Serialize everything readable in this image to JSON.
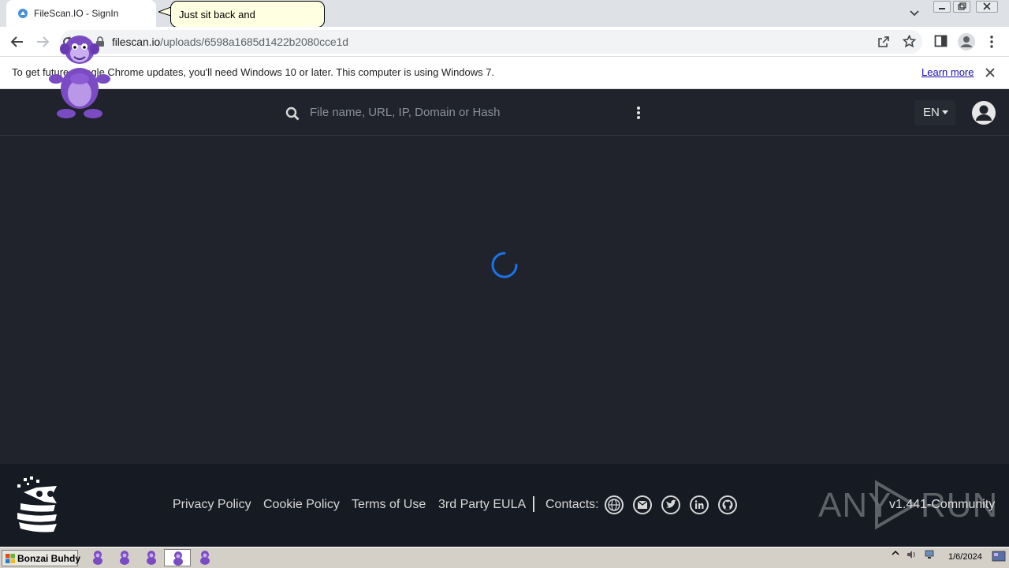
{
  "browser": {
    "tab_title": "FileScan.IO - SignIn",
    "url_host": "filescan.io",
    "url_path": "/uploads/6598a1685d1422b2080cce1d",
    "infobar_text": "To get future Google Chrome updates, you'll need Windows 10 or later. This computer is using Windows 7.",
    "infobar_link": "Learn more"
  },
  "tooltip": {
    "text": "Just sit back and"
  },
  "navbar": {
    "search_placeholder": "File name, URL, IP, Domain or Hash",
    "language": "EN"
  },
  "footer": {
    "links": [
      "Privacy Policy",
      "Cookie Policy",
      "Terms of Use",
      "3rd Party EULA"
    ],
    "contacts_label": "Contacts:",
    "contact_icons": [
      "globe-icon",
      "mail-icon",
      "twitter-icon",
      "linkedin-icon",
      "github-icon"
    ],
    "watermark_text": "ANY",
    "watermark_text2": "RUN",
    "version": "v1.441-Community"
  },
  "taskbar": {
    "start_label": "Bonzai Buhdy",
    "clock_date": "1/6/2024"
  },
  "colors": {
    "page_bg": "#20232b",
    "footer_bg": "#161a22",
    "spinner": "#1a73e8"
  }
}
